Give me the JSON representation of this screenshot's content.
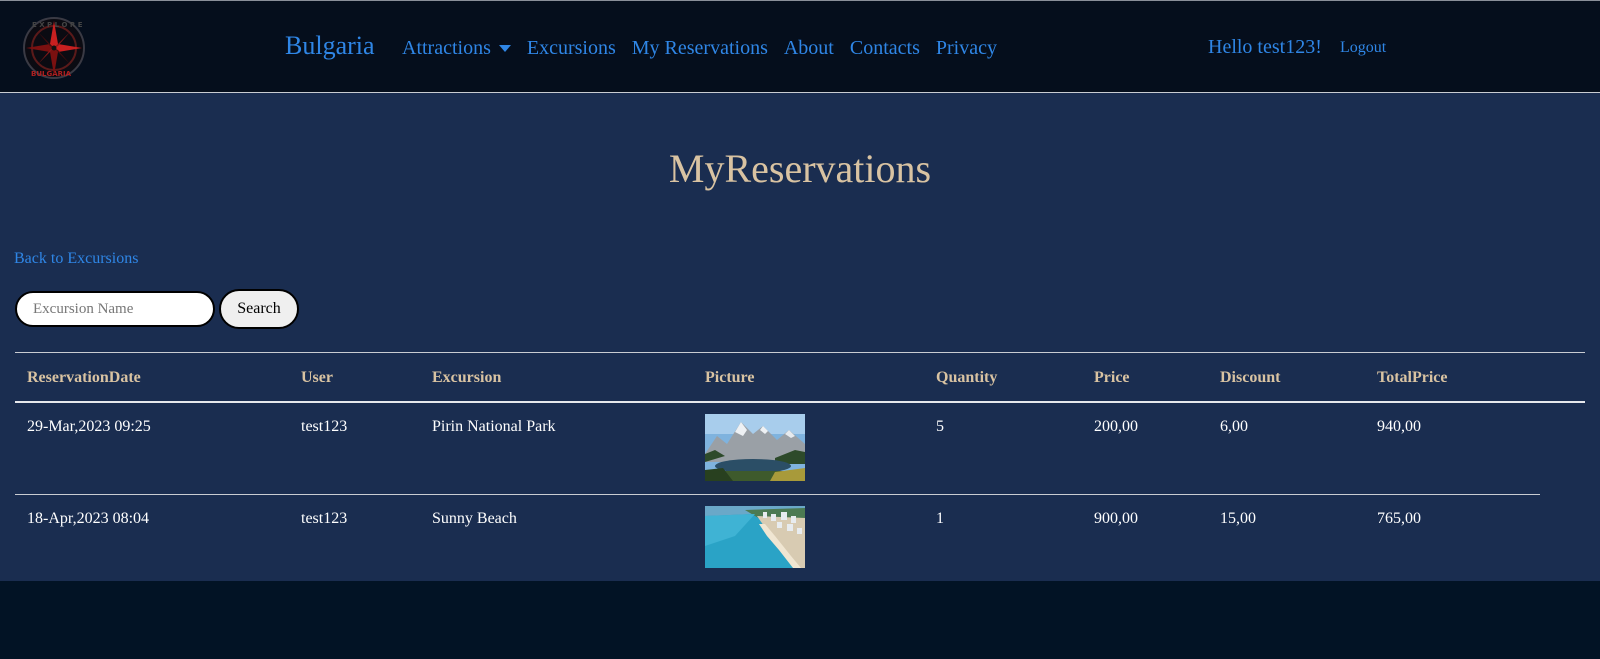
{
  "nav": {
    "brand": "Bulgaria",
    "links": [
      "Attractions",
      "Excursions",
      "My Reservations",
      "About",
      "Contacts",
      "Privacy"
    ],
    "greeting": "Hello test123!",
    "logout": "Logout"
  },
  "page": {
    "title": "MyReservations",
    "back_link": "Back to Excursions"
  },
  "search": {
    "placeholder": "Excursion Name",
    "button": "Search"
  },
  "table": {
    "headers": [
      "ReservationDate",
      "User",
      "Excursion",
      "Picture",
      "Quantity",
      "Price",
      "Discount",
      "TotalPrice"
    ],
    "rows": [
      {
        "date": "29-Mar,2023 09:25",
        "user": "test123",
        "excursion": "Pirin National Park",
        "picture": "mountain-lake-photo",
        "quantity": "5",
        "price": "200,00",
        "discount": "6,00",
        "total": "940,00"
      },
      {
        "date": "18-Apr,2023 08:04",
        "user": "test123",
        "excursion": "Sunny Beach",
        "picture": "beach-resort-photo",
        "quantity": "1",
        "price": "900,00",
        "discount": "15,00",
        "total": "765,00"
      }
    ]
  },
  "colors": {
    "navbar_bg": "#050e1c",
    "main_bg": "#1a2d50",
    "page_bg": "#021325",
    "link": "#2f86e6",
    "heading": "#d9c3a2"
  }
}
